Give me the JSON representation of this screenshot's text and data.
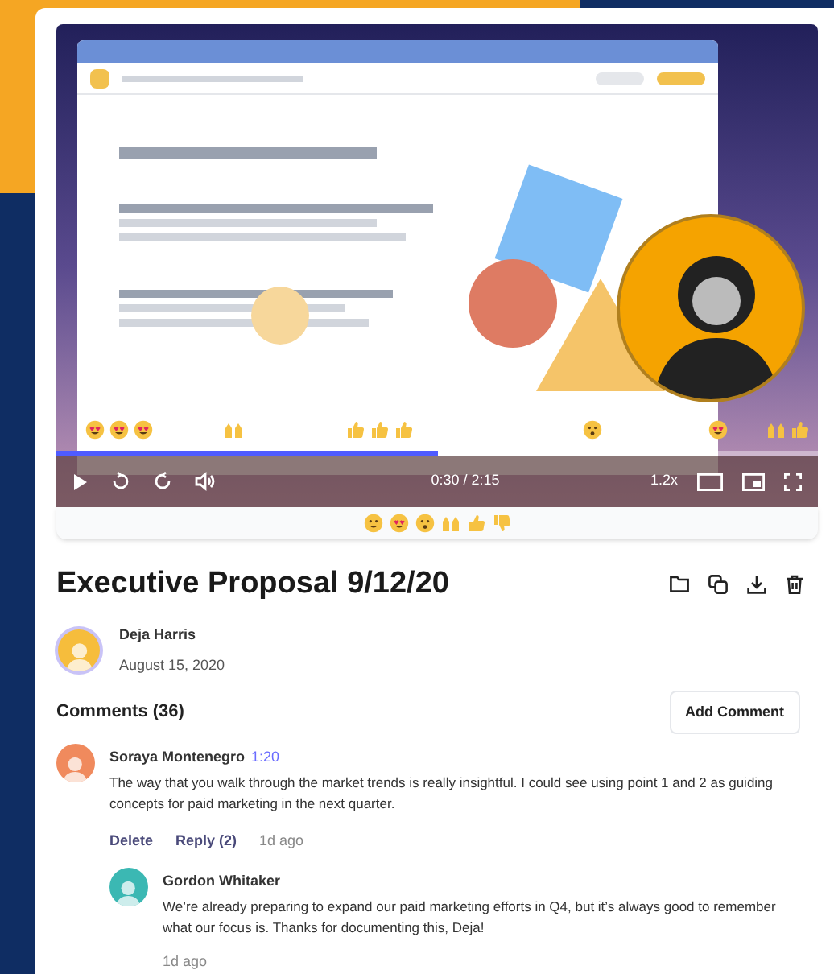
{
  "player": {
    "time": "0:30 / 2:15",
    "speed": "1.2x",
    "progress": {
      "level": 0.5
    }
  },
  "title": "Executive Proposal 9/12/20",
  "author": {
    "name": "Deja Harris",
    "date": "August 15, 2020"
  },
  "comments_header": {
    "title": "Comments (36)",
    "button": "Add Comment"
  },
  "comments": [
    {
      "name": "Soraya Montenegro",
      "timestamp": "1:20",
      "text": "The way that you walk through the market trends is really insightful. I could see using point 1 and 2 as guiding concepts for paid marketing in the next quarter.",
      "actions": [
        "Delete",
        "Reply (2)"
      ],
      "age": "1d ago",
      "color": "#f08a5d",
      "replies": [
        {
          "name": "Gordon Whitaker",
          "text": "We’re already preparing to expand our paid marketing efforts in Q4, but it’s always good to remember what our focus is. Thanks for documenting this, Deja!",
          "age": "1d ago",
          "color": "#3bb8b3"
        }
      ]
    }
  ]
}
